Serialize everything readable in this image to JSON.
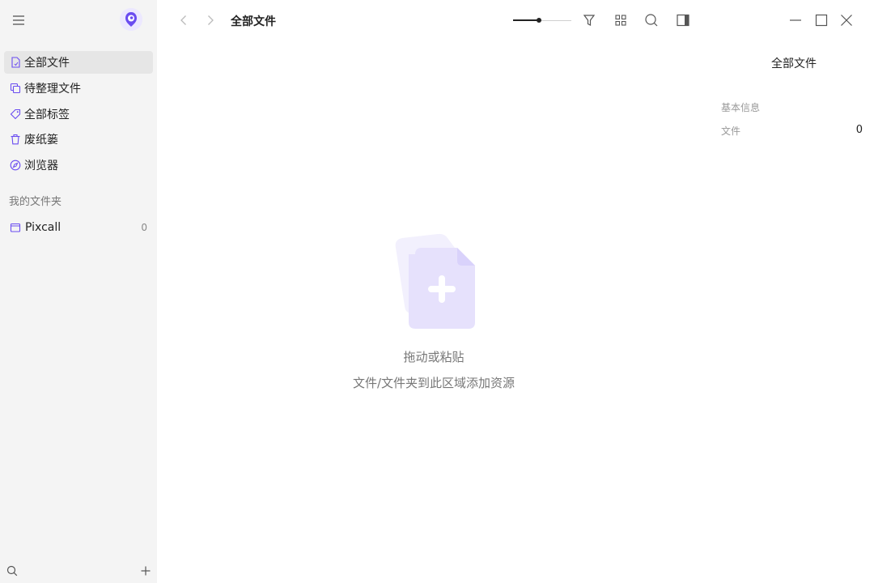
{
  "sidebar": {
    "nav": [
      {
        "label": "全部文件",
        "icon": "file-icon",
        "active": true
      },
      {
        "label": "待整理文件",
        "icon": "copy-icon",
        "active": false
      },
      {
        "label": "全部标签",
        "icon": "tag-icon",
        "active": false
      },
      {
        "label": "废纸篓",
        "icon": "trash-icon",
        "active": false
      },
      {
        "label": "浏览器",
        "icon": "compass-icon",
        "active": false
      }
    ],
    "section_title": "我的文件夹",
    "folders": [
      {
        "label": "Pixcall",
        "count": "0",
        "icon": "folder-icon"
      }
    ]
  },
  "toolbar": {
    "title": "全部文件",
    "zoom_level": 0.45
  },
  "info_panel": {
    "title": "全部文件",
    "section": "基本信息",
    "rows": [
      {
        "label": "文件",
        "value": "0"
      }
    ]
  },
  "empty_state": {
    "line1": "拖动或粘贴",
    "line2": "文件/文件夹到此区域添加资源"
  },
  "colors": {
    "accent": "#6a4cf0",
    "sidebar_bg": "#f4f4f4",
    "active_item_bg": "#e6e6e6"
  }
}
